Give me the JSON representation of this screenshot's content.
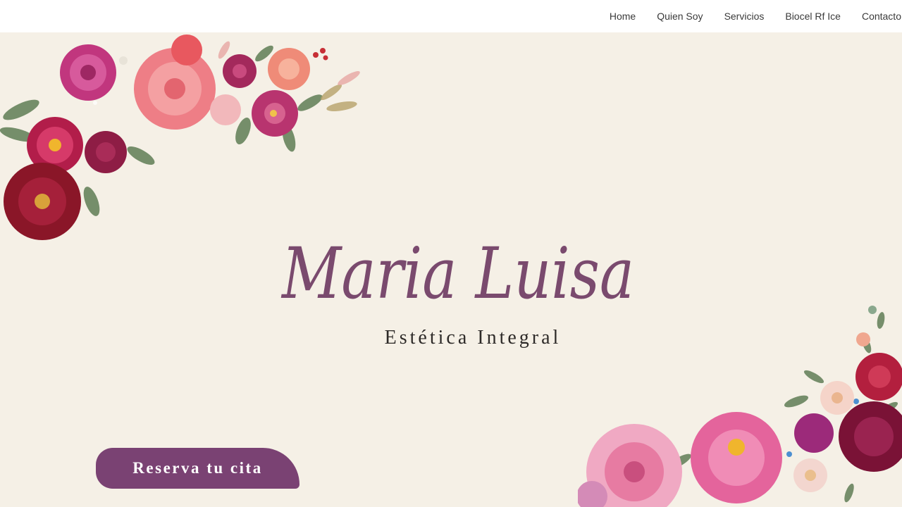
{
  "nav": {
    "items": [
      {
        "label": "Home"
      },
      {
        "label": "Quien Soy"
      },
      {
        "label": "Servicios"
      },
      {
        "label": "Biocel Rf Ice"
      },
      {
        "label": "Contacto"
      }
    ]
  },
  "hero": {
    "brand_name": "Maria Luisa",
    "subtitle": "Estética Integral",
    "cta_label": "Reserva tu cita"
  },
  "colors": {
    "background": "#f5f0e6",
    "navbar": "#ffffff",
    "brand_text": "#7a4a6e",
    "cta": "#7a4273"
  },
  "decorations": {
    "top_left": "watercolor-floral-bouquet",
    "bottom_right": "watercolor-floral-bouquet"
  }
}
